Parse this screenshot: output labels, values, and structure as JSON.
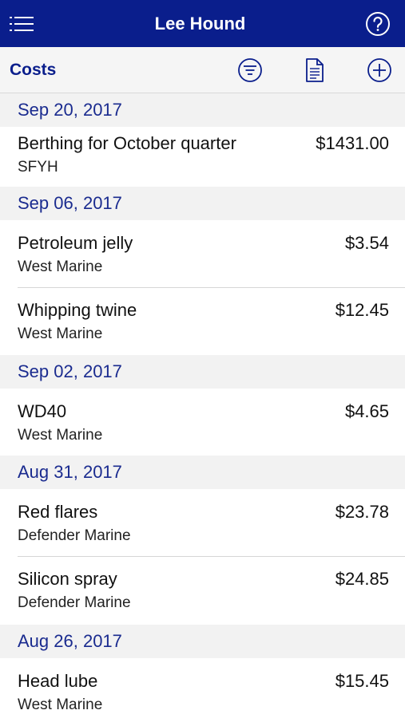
{
  "header": {
    "title": "Lee Hound"
  },
  "toolbar": {
    "title": "Costs"
  },
  "sections": [
    {
      "date": "Sep 20, 2017",
      "items": [
        {
          "name": "Berthing for October quarter",
          "vendor": "SFYH",
          "amount": "$1431.00"
        }
      ]
    },
    {
      "date": "Sep 06, 2017",
      "items": [
        {
          "name": "Petroleum jelly",
          "vendor": "West Marine",
          "amount": "$3.54"
        },
        {
          "name": "Whipping twine",
          "vendor": "West Marine",
          "amount": "$12.45"
        }
      ]
    },
    {
      "date": "Sep 02, 2017",
      "items": [
        {
          "name": "WD40",
          "vendor": "West Marine",
          "amount": "$4.65"
        }
      ]
    },
    {
      "date": "Aug 31, 2017",
      "items": [
        {
          "name": "Red flares",
          "vendor": "Defender Marine",
          "amount": "$23.78"
        },
        {
          "name": "Silicon spray",
          "vendor": "Defender Marine",
          "amount": "$24.85"
        }
      ]
    },
    {
      "date": "Aug 26, 2017",
      "items": [
        {
          "name": "Head lube",
          "vendor": "West Marine",
          "amount": "$15.45"
        }
      ]
    }
  ],
  "colors": {
    "navbar": "#0a1e8c",
    "accent": "#1a2b8f",
    "section_bg": "#f2f2f2"
  },
  "icons": {
    "menu": "menu-icon",
    "help": "help-icon",
    "filter": "filter-icon",
    "document": "document-icon",
    "add": "add-icon"
  }
}
